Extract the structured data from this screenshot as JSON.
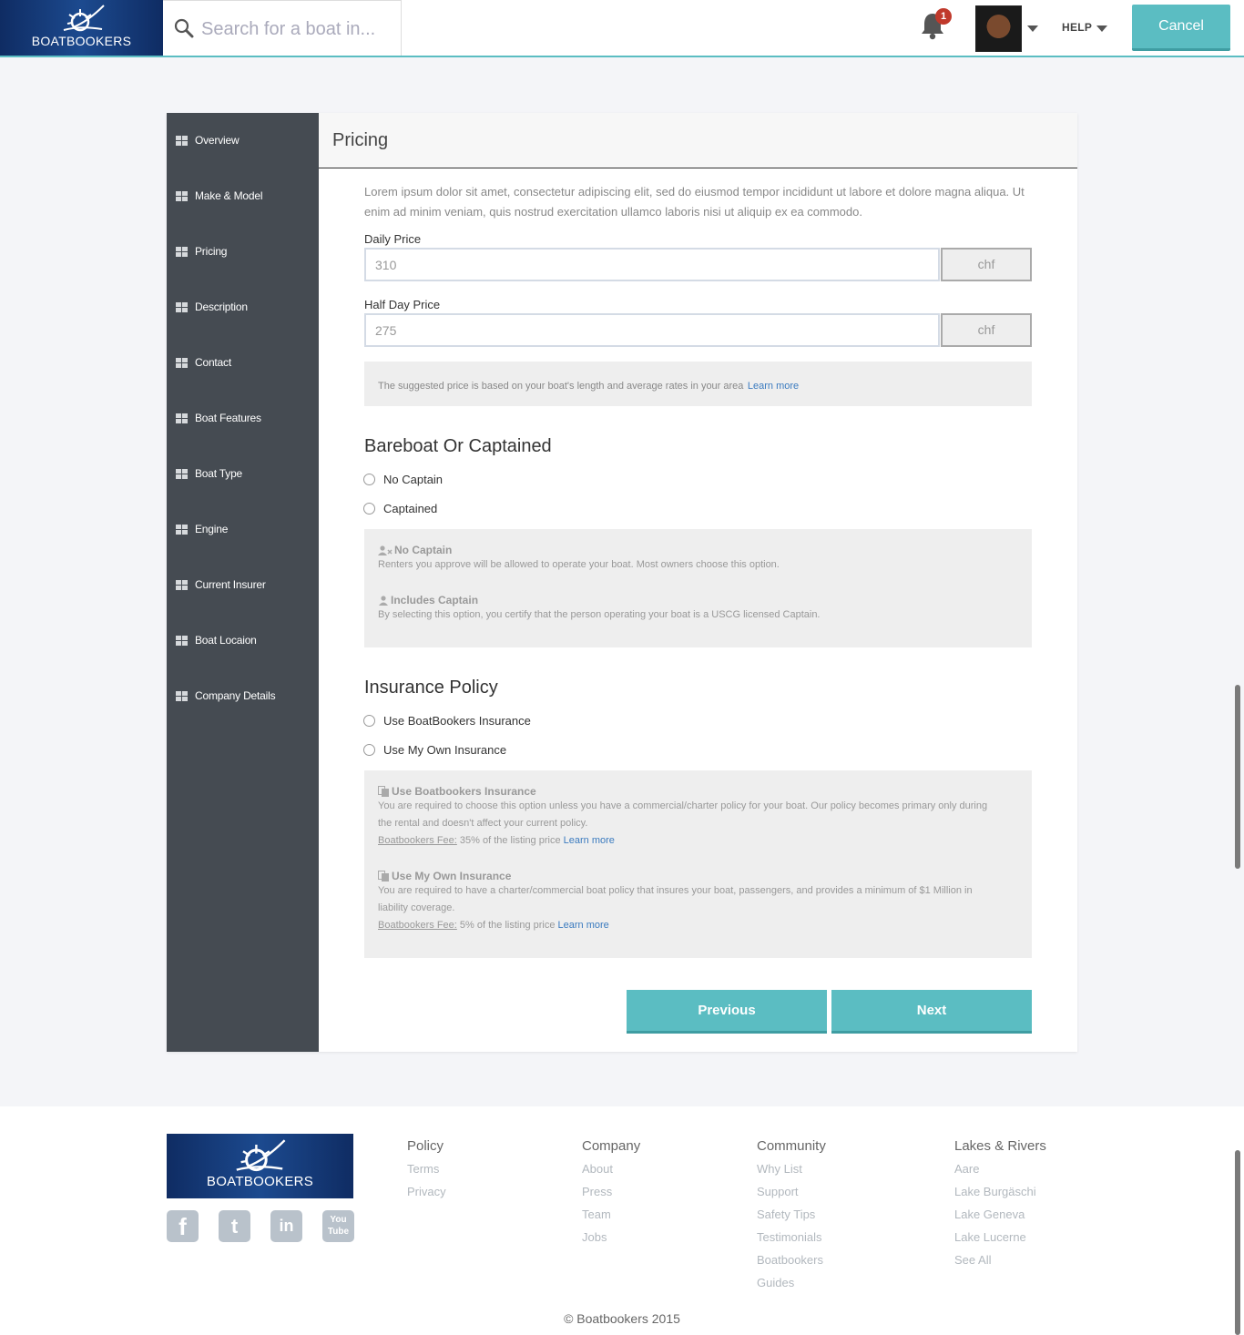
{
  "header": {
    "logo_text": "BOATBOOKERS",
    "search_placeholder": "Search for a boat in...",
    "notification_count": "1",
    "help_label": "HELP",
    "cancel_label": "Cancel"
  },
  "sidebar": {
    "items": [
      {
        "label": "Overview"
      },
      {
        "label": "Make & Model"
      },
      {
        "label": "Pricing"
      },
      {
        "label": "Description"
      },
      {
        "label": "Contact"
      },
      {
        "label": "Boat Features"
      },
      {
        "label": "Boat Type"
      },
      {
        "label": "Engine"
      },
      {
        "label": "Current Insurer"
      },
      {
        "label": "Boat Locaion"
      },
      {
        "label": "Company Details"
      }
    ]
  },
  "pricing": {
    "title": "Pricing",
    "intro": "Lorem ipsum dolor sit amet, consectetur adipiscing elit, sed do eiusmod tempor incididunt ut labore et dolore magna aliqua. Ut enim ad minim veniam, quis nostrud exercitation ullamco laboris nisi ut aliquip ex ea commodo.",
    "daily_label": "Daily Price",
    "daily_value": "310",
    "half_day_label": "Half Day Price",
    "half_day_value": "275",
    "unit": "chf",
    "suggestion_text": "The suggested price is based on your boat's length and average rates in your area",
    "learn_more": "Learn more"
  },
  "bareboat": {
    "title": "Bareboat Or Captained",
    "options": [
      {
        "label": "No Captain"
      },
      {
        "label": "Captained"
      }
    ],
    "info": [
      {
        "title": "No Captain",
        "body": "Renters you approve will be allowed to operate your boat. Most owners choose this option."
      },
      {
        "title": "Includes Captain",
        "body": "By selecting this option, you certify that the person operating your boat is a USCG licensed Captain."
      }
    ]
  },
  "insurance": {
    "title": "Insurance Policy",
    "options": [
      {
        "label": "Use BoatBookers Insurance"
      },
      {
        "label": "Use My Own Insurance"
      }
    ],
    "info": [
      {
        "title": "Use Boatbookers Insurance",
        "body_line1": "You are required to choose this option unless you have a commercial/charter policy for your boat. Our policy becomes primary only during",
        "body_line2": "the rental and doesn't affect your current policy.",
        "fee_label": "Boatbookers Fee:",
        "fee_text": "35% of the listing price",
        "learn_more": "Learn more"
      },
      {
        "title": "Use My Own Insurance",
        "body_line1": "You are required to have a charter/commercial boat policy that insures your boat, passengers, and provides a minimum of $1 Million in",
        "body_line2": "liability coverage.",
        "fee_label": "Boatbookers Fee:",
        "fee_text": "5% of the listing price",
        "learn_more": "Learn more"
      }
    ]
  },
  "nav_buttons": {
    "previous": "Previous",
    "next": "Next"
  },
  "footer": {
    "logo_text": "BOATBOOKERS",
    "social": [
      {
        "name": "facebook-icon",
        "glyph": "f"
      },
      {
        "name": "twitter-icon",
        "glyph": "t"
      },
      {
        "name": "linkedin-icon",
        "glyph": "in"
      },
      {
        "name": "youtube-icon",
        "glyph": "You Tube"
      }
    ],
    "columns": [
      {
        "title": "Policy",
        "links": [
          "Terms",
          "Privacy"
        ]
      },
      {
        "title": "Company",
        "links": [
          "About",
          "Press",
          "Team",
          "Jobs"
        ]
      },
      {
        "title": "Community",
        "links": [
          "Why List",
          "Support",
          "Safety Tips",
          "Testimonials",
          "Boatbookers",
          "Guides"
        ]
      },
      {
        "title": "Lakes & Rivers",
        "links": [
          "Aare",
          "Lake Burgäschi",
          "Lake Geneva",
          "Lake Lucerne",
          "See All"
        ]
      }
    ],
    "copyright": "© Boatbookers 2015"
  }
}
